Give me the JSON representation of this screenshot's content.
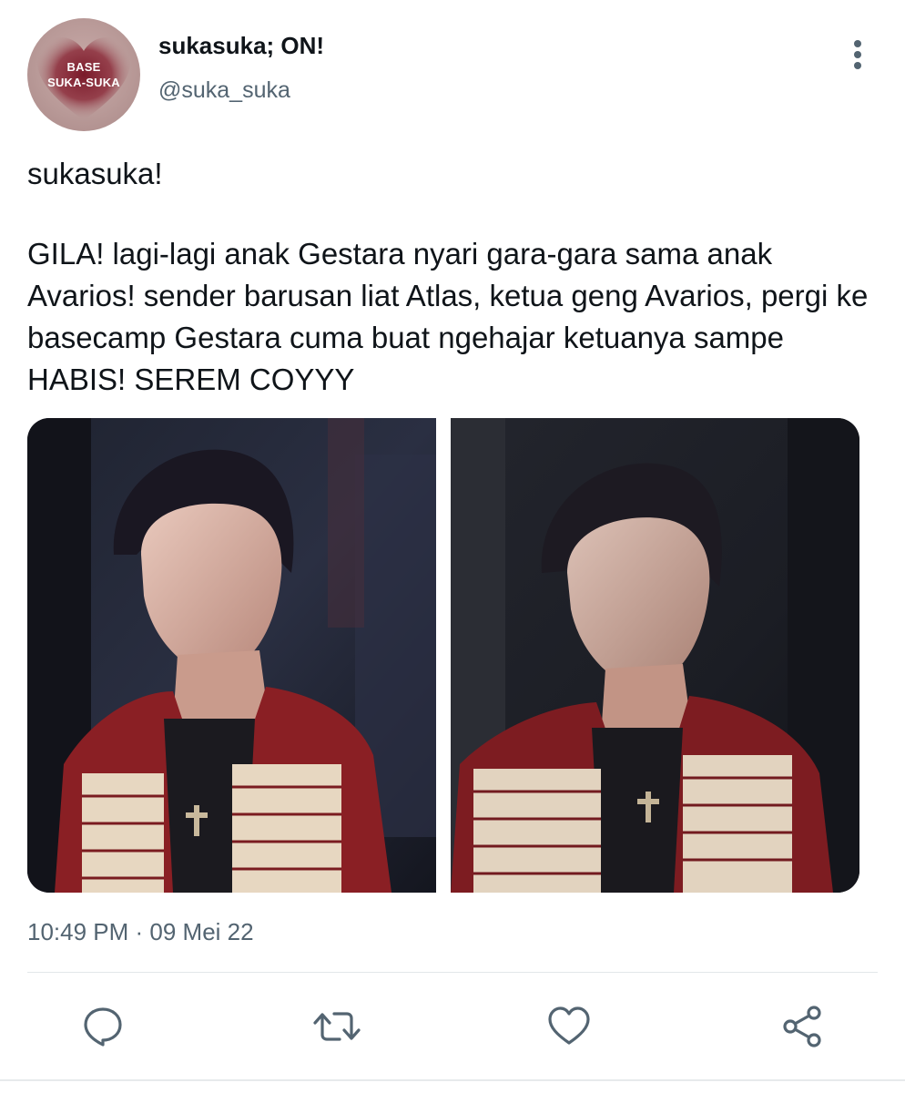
{
  "author": {
    "display_name": "sukasuka; ON!",
    "handle": "@suka_suka",
    "avatar": {
      "line1": "BASE",
      "line2": "SUKA-SUKA",
      "heart_color": "#7a1a2a",
      "bg_color": "#b99a98"
    }
  },
  "tweet": {
    "paragraph1": "sukasuka!",
    "paragraph2": "GILA! lagi-lagi anak Gestara nyari gara-gara sama anak Avarios! sender barusan liat Atlas, ketua geng Avarios, pergi ke basecamp Gestara cuma buat ngehajar ketuanya sampe HABIS! SEREM COYYY"
  },
  "media": {
    "count": 2
  },
  "timestamp": "10:49 PM · 09 Mei 22",
  "actions": {
    "icons": [
      "reply-icon",
      "retweet-icon",
      "like-icon",
      "share-icon"
    ]
  },
  "colors": {
    "text": "#0f1419",
    "secondary": "#536471",
    "icon": "#536471",
    "divider": "#e3e7ea"
  }
}
